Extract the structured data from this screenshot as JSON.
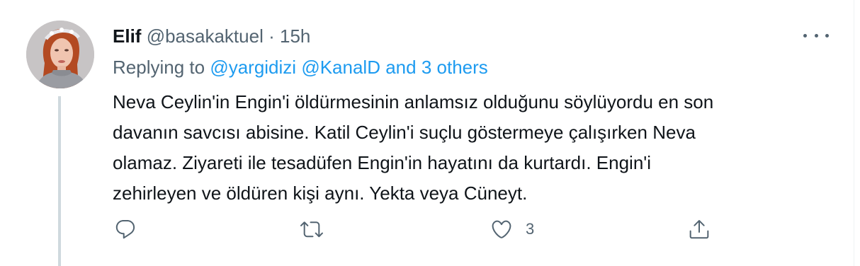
{
  "tweet": {
    "author": {
      "name": "Elif",
      "handle": "@basakaktuel",
      "separator": "·",
      "time": "15h"
    },
    "replying": {
      "prefix": "Replying to",
      "user1": "@yargidizi",
      "user2": "@KanalD",
      "others": "and 3 others"
    },
    "text_lines": [
      "Neva Ceylin'in Engin'i öldürmesinin anlamsız olduğunu söylüyordu en son",
      "davanın savcısı abisine. Katil Ceylin'i suçlu göstermeye çalışırken Neva",
      "olamaz. Ziyareti ile tesadüfen Engin'in hayatını da kurtardı. Engin'i",
      "zehirleyen ve öldüren kişi aynı. Yekta veya Cüneyt."
    ],
    "actions": {
      "like_count": "3"
    },
    "icons": {
      "more": "more-horizontal-icon",
      "reply": "reply-icon",
      "retweet": "retweet-icon",
      "like": "heart-icon",
      "share": "share-icon"
    }
  }
}
